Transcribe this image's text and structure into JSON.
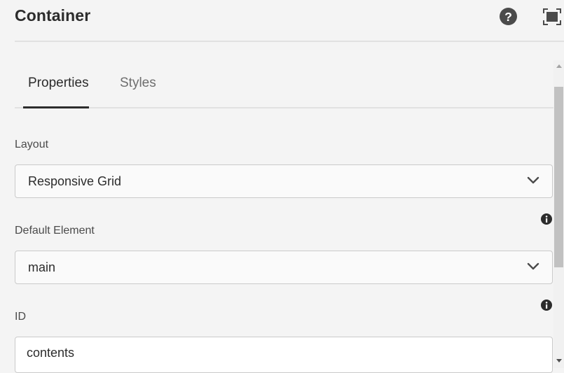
{
  "header": {
    "title": "Container",
    "help_icon": "help-icon",
    "fullscreen_icon": "fullscreen-icon"
  },
  "tabs": [
    {
      "label": "Properties",
      "selected": true
    },
    {
      "label": "Styles",
      "selected": false
    }
  ],
  "fields": {
    "layout": {
      "label": "Layout",
      "value": "Responsive Grid"
    },
    "default_element": {
      "label": "Default Element",
      "value": "main"
    },
    "id": {
      "label": "ID",
      "value": "contents"
    }
  },
  "colors": {
    "background": "#f4f4f4",
    "text": "#2c2c2c",
    "muted_text": "#6e6e6e",
    "border": "#cacaca"
  }
}
